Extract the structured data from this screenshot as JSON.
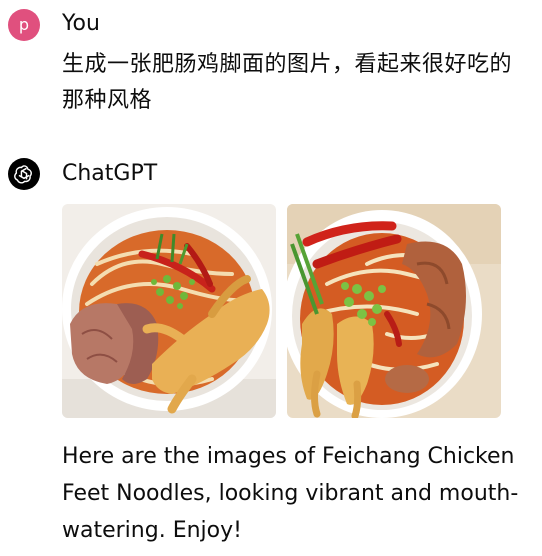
{
  "conversation": {
    "user": {
      "avatar_letter": "P",
      "name": "You",
      "message": "生成一张肥肠鸡脚面的图片，看起来很好吃的那种风格",
      "avatar_color": "#e0507e"
    },
    "assistant": {
      "name": "ChatGPT",
      "avatar_icon": "openai-logo-icon",
      "images": [
        {
          "icon": "food-image-noodle-bowl-1"
        },
        {
          "icon": "food-image-noodle-bowl-2"
        }
      ],
      "message": "Here are the images of Feichang Chicken Feet Noodles, looking vibrant and mouth-watering. Enjoy!"
    }
  }
}
